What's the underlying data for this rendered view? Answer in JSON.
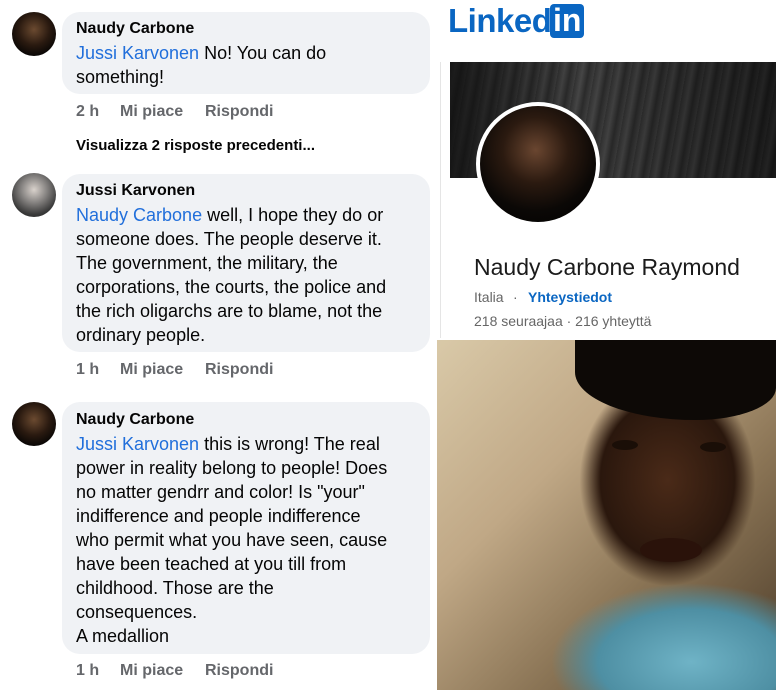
{
  "comments": [
    {
      "author": "Naudy Carbone",
      "mention": "Jussi Karvonen",
      "lines": [
        " No! You can do",
        "something!"
      ],
      "time": "2 h",
      "like": "Mi piace",
      "reply": "Rispondi"
    },
    {
      "author": "Jussi Karvonen",
      "mention": "Naudy Carbone",
      "lines": [
        " well, I hope they do or",
        "someone does. The people deserve it.",
        "The government, the military, the",
        "corporations, the courts, the police and",
        "the rich oligarchs are to blame, not the",
        "ordinary people."
      ],
      "time": "1 h",
      "like": "Mi piace",
      "reply": "Rispondi"
    },
    {
      "author": "Naudy Carbone",
      "mention": "Jussi Karvonen",
      "lines": [
        " this is wrong! The real",
        "power in reality belong to people! Does",
        "no matter gendrr and color! Is \"your\"",
        "indifference and people indifference",
        "who permit what you have seen, cause",
        "have been teached at you till from",
        "childhood. Those are the",
        "consequences.",
        "A medallion"
      ],
      "time": "1 h",
      "like": "Mi piace",
      "reply": "Rispondi"
    }
  ],
  "previous_replies": "Visualizza 2 risposte precedenti...",
  "linkedin": {
    "logo_word": "Linked",
    "logo_box": "in",
    "name": "Naudy Carbone Raymond",
    "location": "Italia",
    "separator": "·",
    "contact": "Yhteystiedot",
    "stats": "218 seuraajaa · 216 yhteyttä",
    "brand_color": "#0a66c2"
  },
  "colors": {
    "mention": "#216fdb",
    "bubble": "#f0f2f5",
    "meta": "#65676b"
  }
}
